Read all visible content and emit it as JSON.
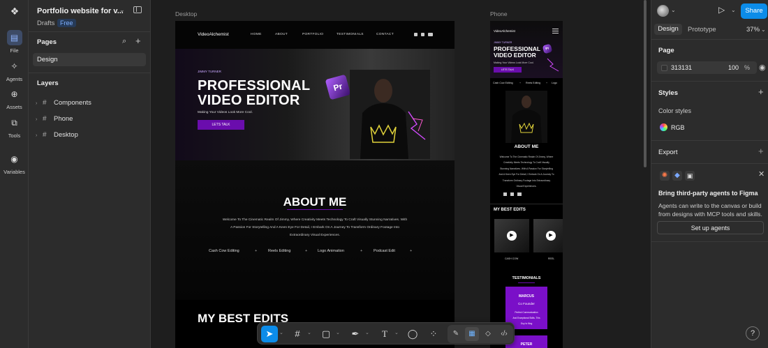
{
  "rail": {
    "items": [
      {
        "label": "File",
        "icon": "file-icon"
      },
      {
        "label": "Agents",
        "icon": "agents-icon"
      },
      {
        "label": "Assets",
        "icon": "assets-icon"
      },
      {
        "label": "Tools",
        "icon": "tools-icon"
      },
      {
        "label": "Variables",
        "icon": "variables-icon"
      }
    ]
  },
  "left_panel": {
    "title": "Portfolio website for v...",
    "drafts": "Drafts",
    "plan_badge": "Free",
    "pages_heading": "Pages",
    "pages": [
      "Design"
    ],
    "layers_heading": "Layers",
    "layers": [
      "Components",
      "Phone",
      "Desktop"
    ]
  },
  "canvas": {
    "desktop_label": "Desktop",
    "phone_label": "Phone",
    "desktop": {
      "logo": "VideoAlchemist",
      "menu": [
        "HOME",
        "ABOUT",
        "PORTFOLIO",
        "TESTIMONIALS",
        "CONTACT"
      ],
      "hero_name": "JIMMY TURNER",
      "hero_title_1": "PROFESSIONAL",
      "hero_title_2": "VIDEO EDITOR",
      "hero_sub": "Making Your Videos Look More Cool.",
      "cta": "LETS TALK",
      "about_heading": "ABOUT ME",
      "about_text_1": "Welcome To The Cinematic Realm Of Jimmy, Where Creativity Meets Technology To Craft Visually Stunning Narratives. With",
      "about_text_2": "A Passion For Storytelling And A Keen Eye For Detail, I Embark On A Journey To Transform Ordinary Footage Into",
      "about_text_3": "Extraordinary Visual Experiences.",
      "skills": [
        "Cash Cow Editing",
        "Reels Editing",
        "Logo Animation",
        "Podcast Edit"
      ],
      "edits_heading": "MY BEST EDITS"
    },
    "phone": {
      "logo": "VideoAlchemist",
      "hero_name": "JIMMY TURNER",
      "hero_title_1": "PROFESSIONAL",
      "hero_title_2": "VIDEO EDITOR",
      "hero_sub": "Making Your Videos Look More Cool.",
      "cta": "LETS TALK",
      "skills": [
        "Cash Cow Editing",
        "Reels Editing",
        "Logo"
      ],
      "about_heading": "ABOUT ME",
      "about_lines": [
        "Welcome To The Cinematic Realm Of Jimmy, Where",
        "Creativity Meets Technology To Craft Visually",
        "Stunning Narratives. With A Passion For Storytelling",
        "And A Keen Eye For Detail, I Embark On A Journey To",
        "Transform Ordinary Footage Into Extraordinary",
        "Visual Experiences."
      ],
      "edits_heading": "MY BEST EDITS",
      "thumb_captions": [
        "CASH COW",
        "REEL"
      ],
      "testimonials_heading": "TESTIMONIALS",
      "testimonial_name": "MARCUS",
      "testimonial_role": "Co Founder",
      "testimonial_text": [
        "Perfect Communication",
        "And Exceptional Skills. This",
        "Guy Is King"
      ],
      "testimonial2_name": "PETER"
    }
  },
  "right_panel": {
    "share": "Share",
    "tabs": [
      "Design",
      "Prototype"
    ],
    "zoom": "37%",
    "page_heading": "Page",
    "page_color": "313131",
    "page_opacity": "100",
    "percent": "%",
    "styles_heading": "Styles",
    "color_styles": "Color styles",
    "rgb": "RGB",
    "export_heading": "Export",
    "promo_title": "Bring third-party agents to Figma",
    "promo_text": "Agents can write to the canvas or build from designs with MCP tools and skills.",
    "promo_button": "Set up agents",
    "help": "?"
  },
  "toolbar": {
    "tools": [
      "move-tool",
      "frame-tool",
      "shape-tool",
      "pen-tool",
      "text-tool",
      "comment-tool",
      "actions-tool"
    ],
    "dev_tools": [
      "draw-mode",
      "design-mode",
      "dev-mode",
      "code-mode"
    ]
  }
}
